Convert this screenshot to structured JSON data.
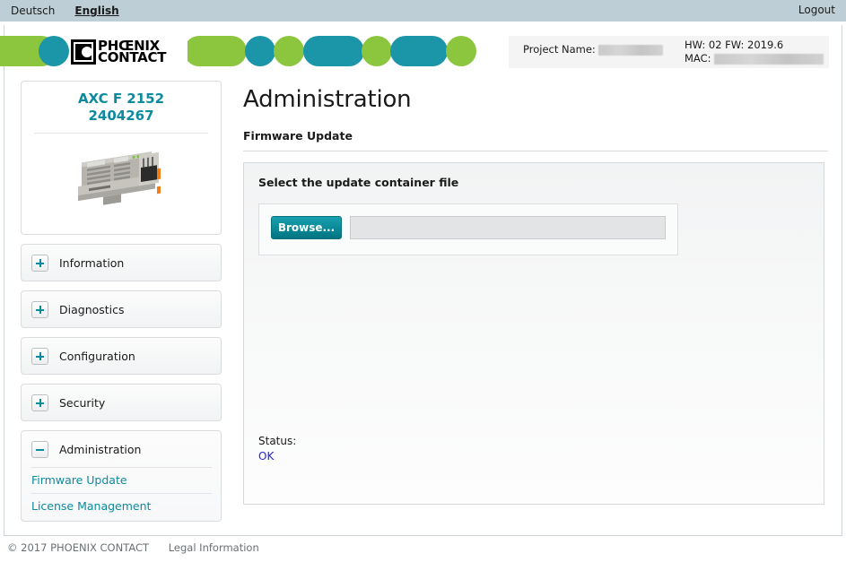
{
  "topbar": {
    "lang_de": "Deutsch",
    "lang_en": "English",
    "logout": "Logout"
  },
  "header": {
    "logo_line1": "PHŒNIX",
    "logo_line2": "CONTACT",
    "project_label": "Project Name:",
    "project_value": "",
    "hw_fw": "HW: 02 FW: 2019.6",
    "mac_label": "MAC:",
    "mac_value": "",
    "colors": {
      "green": "#8cc63e",
      "teal": "#1b95a8"
    }
  },
  "sidebar": {
    "device_name": "AXC F 2152",
    "device_order_no": "2404267",
    "items": [
      {
        "label": "Information",
        "state": "collapsed",
        "toggle": "plus-icon"
      },
      {
        "label": "Diagnostics",
        "state": "collapsed",
        "toggle": "plus-icon"
      },
      {
        "label": "Configuration",
        "state": "collapsed",
        "toggle": "plus-icon"
      },
      {
        "label": "Security",
        "state": "collapsed",
        "toggle": "plus-icon"
      },
      {
        "label": "Administration",
        "state": "expanded",
        "toggle": "minus-icon"
      }
    ],
    "administration_sublinks": [
      {
        "label": "Firmware Update",
        "active": true
      },
      {
        "label": "License Management",
        "active": false
      }
    ]
  },
  "main": {
    "page_title": "Administration",
    "section_title": "Firmware Update",
    "panel_title": "Select the update container file",
    "browse_label": "Browse...",
    "file_value": "",
    "file_placeholder": "",
    "status_label": "Status:",
    "status_value": "OK",
    "status_color": "#2222dd"
  },
  "footer": {
    "copyright": "© 2017 PHOENIX CONTACT",
    "legal": "Legal Information"
  }
}
